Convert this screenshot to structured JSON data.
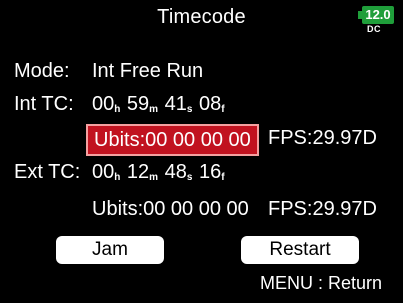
{
  "screen": {
    "title": "Timecode",
    "battery": {
      "voltage": "12.0",
      "source": "DC"
    }
  },
  "mode": {
    "label": "Mode:",
    "value": "Int Free Run"
  },
  "int_tc": {
    "label": "Int TC:",
    "hours": "00",
    "hours_unit": "h",
    "minutes": "59",
    "minutes_unit": "m",
    "seconds": "41",
    "seconds_unit": "s",
    "frames": "08",
    "frames_unit": "f",
    "ubits": "Ubits:00 00 00 00",
    "fps": "FPS:29.97D"
  },
  "ext_tc": {
    "label": "Ext TC:",
    "hours": "00",
    "hours_unit": "h",
    "minutes": "12",
    "minutes_unit": "m",
    "seconds": "48",
    "seconds_unit": "s",
    "frames": "16",
    "frames_unit": "f",
    "ubits": "Ubits:00 00 00 00",
    "fps": "FPS:29.97D"
  },
  "buttons": {
    "jam": "Jam",
    "restart": "Restart"
  },
  "footer": {
    "hint": "MENU : Return"
  },
  "colors": {
    "highlight": "#c1121f",
    "battery": "#1f9e3a",
    "background": "#000000"
  }
}
